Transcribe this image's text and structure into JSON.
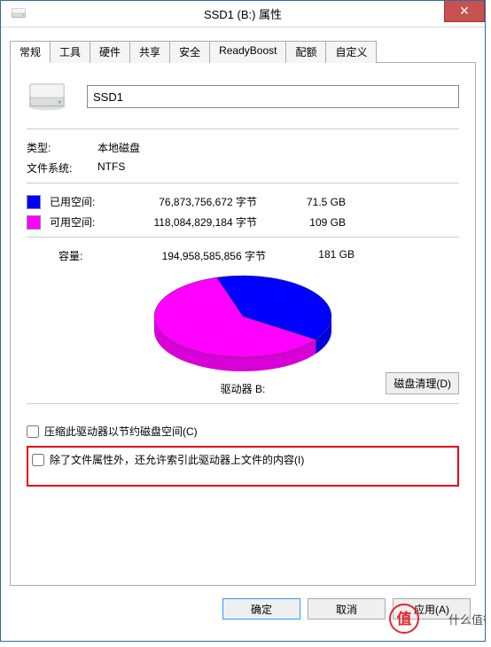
{
  "window": {
    "title": "SSD1 (B:) 属性",
    "close": "✕"
  },
  "tabs": {
    "general": "常规",
    "tools": "工具",
    "hardware": "硬件",
    "sharing": "共享",
    "security": "安全",
    "readyboost": "ReadyBoost",
    "quota": "配额",
    "customize": "自定义"
  },
  "drive": {
    "name_value": "SSD1",
    "type_label": "类型:",
    "type_value": "本地磁盘",
    "fs_label": "文件系统:",
    "fs_value": "NTFS"
  },
  "usage": {
    "used_label": "已用空间:",
    "used_bytes": "76,873,756,672 字节",
    "used_gb": "71.5 GB",
    "used_color": "#0000ff",
    "free_label": "可用空间:",
    "free_bytes": "118,084,829,184 字节",
    "free_gb": "109 GB",
    "free_color": "#ff00ff",
    "capacity_label": "容量:",
    "capacity_bytes": "194,958,585,856 字节",
    "capacity_gb": "181 GB"
  },
  "pie": {
    "drive_label": "驱动器 B:",
    "cleanup_button": "磁盘清理(D)"
  },
  "options": {
    "compress": "压缩此驱动器以节约磁盘空间(C)",
    "index": "除了文件属性外，还允许索引此驱动器上文件的内容(I)"
  },
  "buttons": {
    "ok": "确定",
    "cancel": "取消",
    "apply": "应用(A)"
  },
  "watermark": "什么值得买",
  "chart_data": {
    "type": "pie",
    "title": "驱动器 B:",
    "series": [
      {
        "name": "已用空间",
        "value": 76873756672,
        "display": "71.5 GB",
        "color": "#0000ff"
      },
      {
        "name": "可用空间",
        "value": 118084829184,
        "display": "109 GB",
        "color": "#ff00ff"
      }
    ],
    "total": {
      "value": 194958585856,
      "display": "181 GB"
    }
  }
}
